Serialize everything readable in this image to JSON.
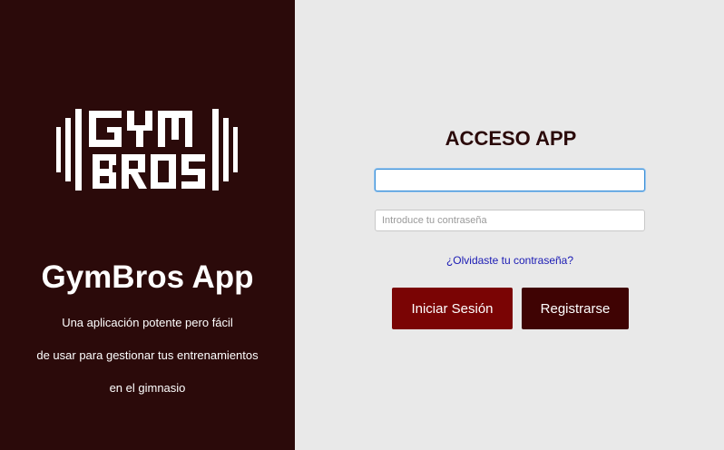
{
  "left_panel": {
    "logo_text": "GYM BROS",
    "app_title": "GymBros App",
    "description_lines": [
      "Una aplicación potente pero fácil",
      "de usar para gestionar tus entrenamientos",
      "en el gimnasio"
    ]
  },
  "login_form": {
    "title": "ACCESO APP",
    "username_value": "",
    "username_placeholder": "",
    "password_placeholder": "Introduce tu contraseña",
    "forgot_password_label": "¿Olvidaste tu contraseña?",
    "login_button_label": "Iniciar Sesión",
    "register_button_label": "Registrarse"
  },
  "colors": {
    "left_panel_bg": "#2b0a0a",
    "right_panel_bg": "#e9e9e9",
    "login_button": "#7a0404",
    "register_button": "#3f0303",
    "link": "#1a1ab4"
  }
}
